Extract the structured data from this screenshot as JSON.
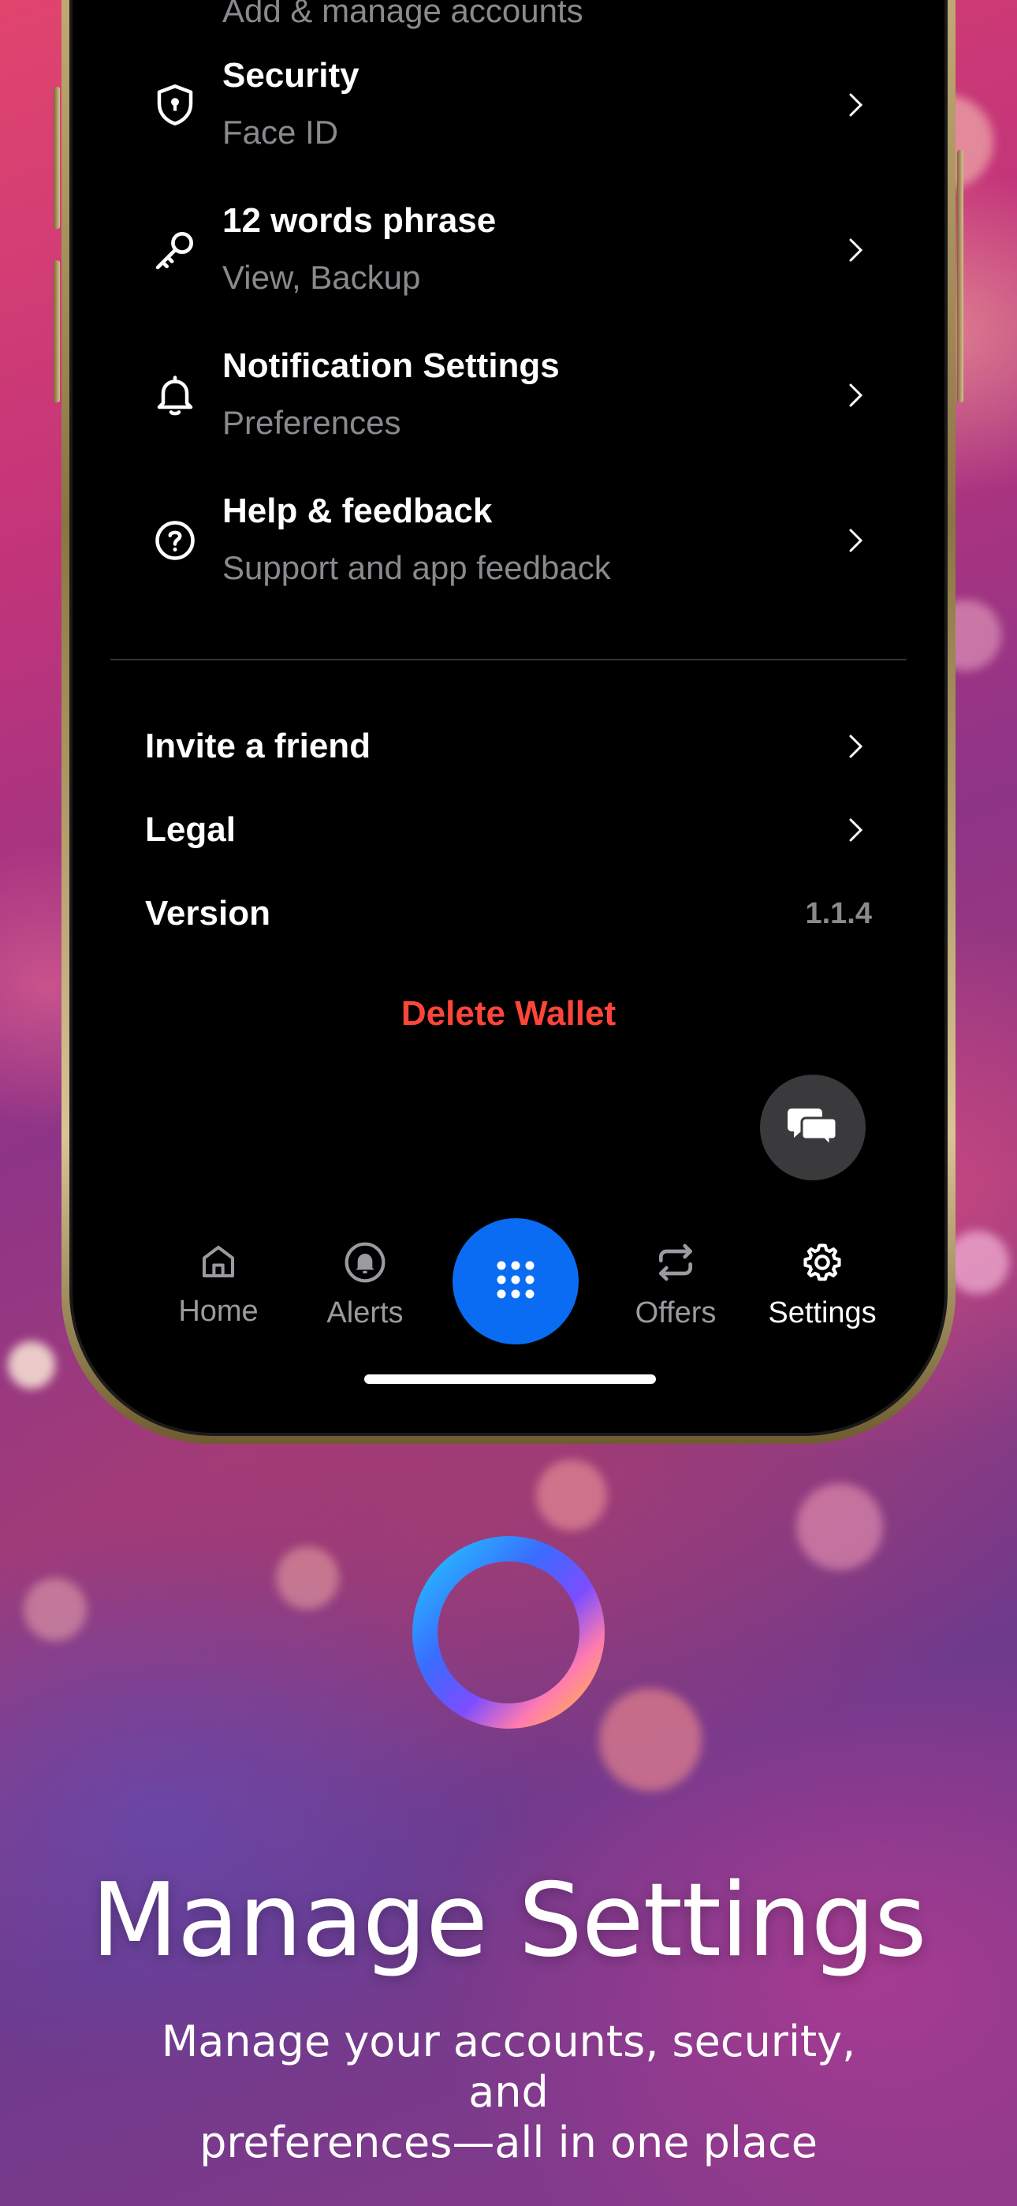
{
  "settings": {
    "partial_top_subtitle": "Add & manage accounts",
    "items": [
      {
        "title": "Security",
        "subtitle": "Face ID",
        "icon": "shield-icon"
      },
      {
        "title": "12 words phrase",
        "subtitle": "View, Backup",
        "icon": "key-icon"
      },
      {
        "title": "Notification Settings",
        "subtitle": "Preferences",
        "icon": "bell-icon"
      },
      {
        "title": "Help & feedback",
        "subtitle": "Support and app feedback",
        "icon": "help-icon"
      }
    ],
    "invite_label": "Invite a friend",
    "legal_label": "Legal",
    "version_label": "Version",
    "version_value": "1.1.4",
    "delete_label": "Delete Wallet"
  },
  "tabbar": {
    "home": "Home",
    "alerts": "Alerts",
    "offers": "Offers",
    "settings": "Settings",
    "active": "Settings"
  },
  "marketing": {
    "headline": "Manage Settings",
    "subline_1": "Manage your accounts, security, and",
    "subline_2": "preferences—all in one place"
  },
  "colors": {
    "accent_blue": "#0a6cf2",
    "danger_red": "#ff453a",
    "muted_text": "#8a8a8e"
  }
}
